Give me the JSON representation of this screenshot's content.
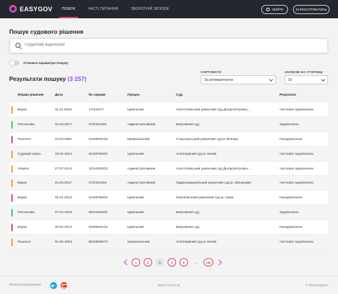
{
  "header": {
    "logo_text": "EASYGOV",
    "nav": [
      {
        "label": "ПОШУК",
        "active": true
      },
      {
        "label": "ЧАСТІ ПИТАННЯ",
        "active": false
      },
      {
        "label": "ЗВОРОТНІЙ ЗВ'ЯЗОК",
        "active": false
      }
    ],
    "login_label": "УВІЙТИ",
    "register_label": "ЗАРЕЄСТРУВАТИСЬ"
  },
  "search": {
    "title": "Пошук судового рішення",
    "placeholder": "Податкові відносини"
  },
  "filters": {
    "refine_label": "Уточнити параметри пошуку",
    "refine_on": false
  },
  "results": {
    "title": "Результати пошуку",
    "count": "(3 257)",
    "sort_label": "СОРТУВАТИ",
    "sort_value": "За релевантністю",
    "per_page_label": "ЗАПИСІВ НА СТОРІНЦІ",
    "per_page_value": "10"
  },
  "table": {
    "columns": [
      "Форма рішення",
      "Дата",
      "№ справи",
      "Процес",
      "Суд",
      "Результат"
    ],
    "rows": [
      {
        "bar": "#f0a030",
        "form": "Вирок",
        "date": "11.01.2018",
        "case": "17/224/17",
        "process": "Цивільний",
        "court": "Апостолівський районний суд Дніпропетровсь…",
        "result": "Частково задоволена"
      },
      {
        "bar": "#3cc46b",
        "form": "Постанова",
        "date": "31.03.2017",
        "case": "072/332284",
        "process": "Адміністративний",
        "court": "Верховний суд",
        "result": "Задоволена"
      },
      {
        "bar": "#e24a5a",
        "form": "Рішення",
        "date": "23.04.2002",
        "case": "943/8910/18",
        "process": "Кримінальний",
        "court": "Староконський районний суд м. Вінниці",
        "result": "Незадоволена"
      },
      {
        "bar": "#f0a030",
        "form": "Судовий наказ",
        "date": "19.02.2014",
        "case": "544/8766/03",
        "process": "Цивільний",
        "court": "Апеляційний суд м. Києва",
        "result": "Частково задоволена"
      },
      {
        "bar": "#f0a030",
        "form": "Ухвала",
        "date": "27.07.2014",
        "case": "101/0045/33",
        "process": "Адміністративний",
        "court": "Апостолівський районний суд Дніпропетровсь…",
        "result": "Частково задоволена"
      },
      {
        "bar": "#f0a030",
        "form": "Вирок",
        "date": "01.05.2017",
        "case": "072/332284",
        "process": "Адміністративний",
        "court": "Орджонікідзевський районний суд м. Запоріжжя",
        "result": "Частково задоволена"
      },
      {
        "bar": "#e24a5a",
        "form": "Вирок",
        "date": "03.01.2010",
        "case": "544/8766/03",
        "process": "Цивільний",
        "court": "Корчагівський районний суд м. Суми",
        "result": "Незадоволена"
      },
      {
        "bar": "#3cc46b",
        "form": "Постанова",
        "date": "27.04.2018",
        "case": "901/6364/02",
        "process": "Цивільний",
        "court": "Верховний суд",
        "result": "Задоволена"
      },
      {
        "bar": "#e24a5a",
        "form": "Вирок",
        "date": "20.02.2013",
        "case": "943/8910/18",
        "process": "Цивільний",
        "court": "Верховний суд",
        "result": "Незадоволена"
      },
      {
        "bar": "#f0a030",
        "form": "Рішення",
        "date": "01.05.2003",
        "case": "802/8808/73",
        "process": "Кримінальний",
        "court": "Апеляційний суд м. Києва",
        "result": "Частково задоволена"
      }
    ]
  },
  "pagination": {
    "pages": [
      "1",
      "2",
      "3",
      "4",
      "5",
      "...",
      "192"
    ],
    "active": "3"
  },
  "footer": {
    "help_text": "Написати розробникам",
    "version": "Версія 1.0.32.40",
    "copyright": "© 2019 EasyGov"
  },
  "colors": {
    "accent": "#e23b6c",
    "count": "#9b4de0",
    "dark_bar": "#24272e"
  }
}
